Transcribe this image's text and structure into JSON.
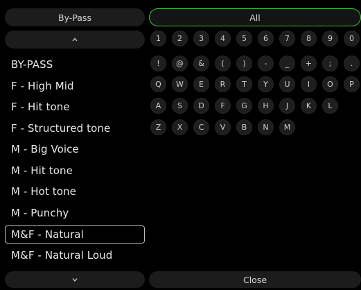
{
  "header": {
    "filter_label": "By-Pass",
    "category_label": "All"
  },
  "presets": [
    "BY-PASS",
    "F - High Mid",
    "F - Hit tone",
    "F - Structured tone",
    "M - Big Voice",
    "M - Hit tone",
    "M - Hot tone",
    "M - Punchy",
    "M&F - Natural",
    "M&F - Natural Loud"
  ],
  "selected_preset": "M&F - Natural",
  "keyboard": {
    "rows": [
      [
        "1",
        "2",
        "3",
        "4",
        "5",
        "6",
        "7",
        "8",
        "9",
        "0"
      ],
      [
        "!",
        "@",
        "&",
        "(",
        ")",
        "-",
        "_",
        "+",
        ";",
        "."
      ],
      [
        "Q",
        "W",
        "E",
        "R",
        "T",
        "Y",
        "U",
        "I",
        "O",
        "P"
      ],
      [
        "A",
        "S",
        "D",
        "F",
        "G",
        "H",
        "J",
        "K",
        "L"
      ],
      [
        "Z",
        "X",
        "C",
        "V",
        "B",
        "N",
        "M"
      ]
    ]
  },
  "footer": {
    "close_label": "Close"
  },
  "icons": {
    "scroll_up": "chevron-up-icon",
    "scroll_down": "chevron-down-icon"
  },
  "colors": {
    "background": "#000000",
    "button_bg": "#1c1c1c",
    "active_border": "#3cc43c",
    "selected_border": "#bdbdbd",
    "text": "#e6e6e6"
  }
}
